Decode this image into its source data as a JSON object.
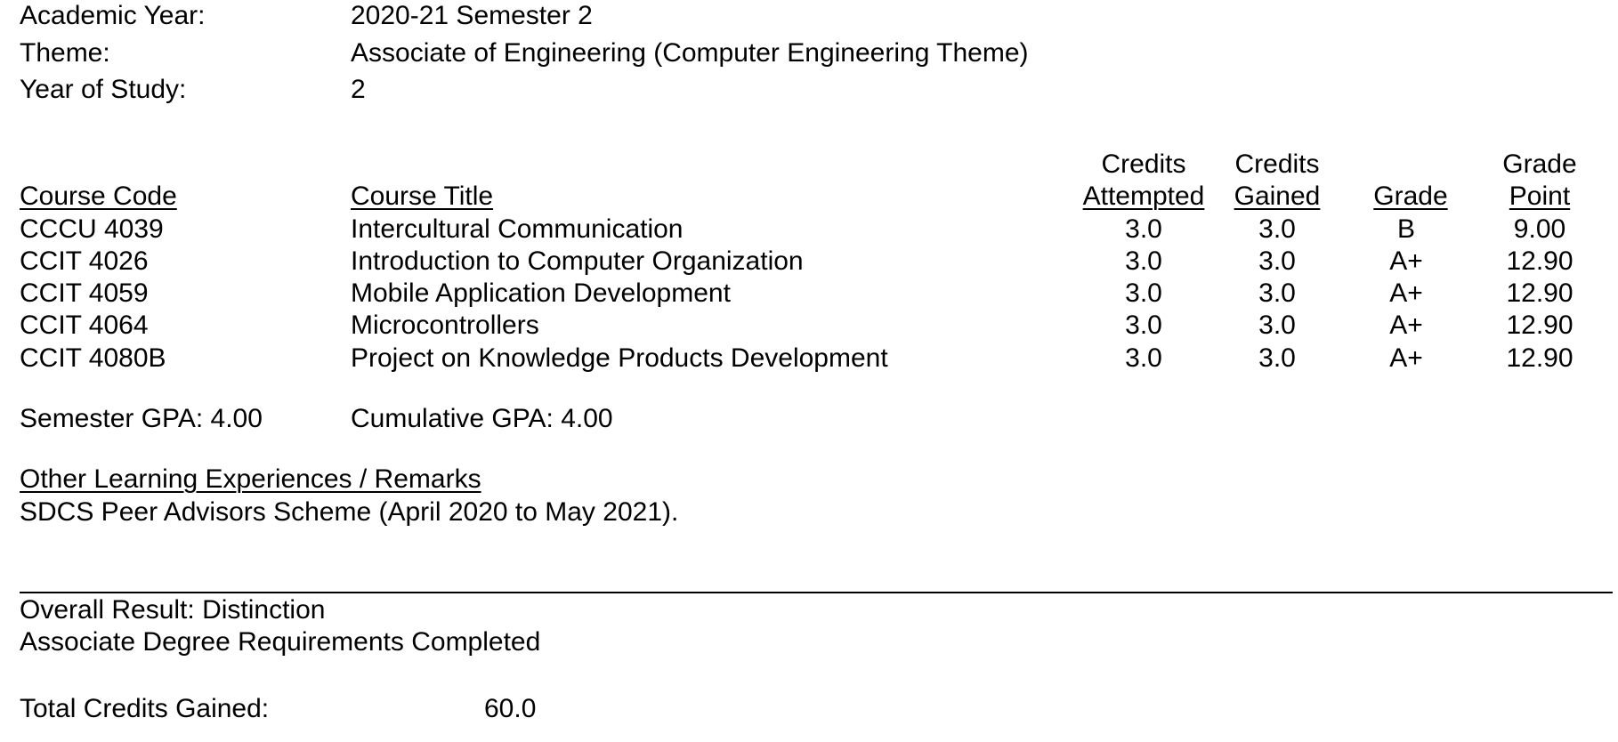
{
  "info": {
    "academic_year_label": "Academic Year:",
    "academic_year_value": "2020-21 Semester 2",
    "theme_label": "Theme:",
    "theme_value": "Associate of Engineering (Computer Engineering Theme)",
    "year_label": "Year of Study:",
    "year_value": "2"
  },
  "table": {
    "headers": {
      "course_code": "Course Code",
      "course_title": "Course Title",
      "credits_attempted_line1": "Credits",
      "credits_attempted_line2": "Attempted",
      "credits_gained_line1": "Credits",
      "credits_gained_line2": "Gained",
      "grade": "Grade",
      "grade_point_line1": "Grade",
      "grade_point_line2": "Point"
    },
    "rows": [
      {
        "code": "CCCU 4039",
        "title": "Intercultural Communication",
        "attempted": "3.0",
        "gained": "3.0",
        "grade": "B",
        "point": "9.00"
      },
      {
        "code": "CCIT 4026",
        "title": "Introduction to Computer Organization",
        "attempted": "3.0",
        "gained": "3.0",
        "grade": "A+",
        "point": "12.90"
      },
      {
        "code": "CCIT 4059",
        "title": "Mobile Application Development",
        "attempted": "3.0",
        "gained": "3.0",
        "grade": "A+",
        "point": "12.90"
      },
      {
        "code": "CCIT 4064",
        "title": "Microcontrollers",
        "attempted": "3.0",
        "gained": "3.0",
        "grade": "A+",
        "point": "12.90"
      },
      {
        "code": "CCIT 4080B",
        "title": "Project on Knowledge Products Development",
        "attempted": "3.0",
        "gained": "3.0",
        "grade": "A+",
        "point": "12.90"
      }
    ]
  },
  "gpa": {
    "semester": "Semester GPA: 4.00",
    "cumulative": "Cumulative GPA: 4.00"
  },
  "remarks": {
    "heading": "Other Learning Experiences / Remarks",
    "text": "SDCS Peer Advisors Scheme (April 2020 to May 2021)."
  },
  "result": {
    "overall": "Overall Result: Distinction",
    "requirements": "Associate Degree Requirements Completed",
    "total_label": "Total Credits Gained:",
    "total_value": "60.0"
  }
}
